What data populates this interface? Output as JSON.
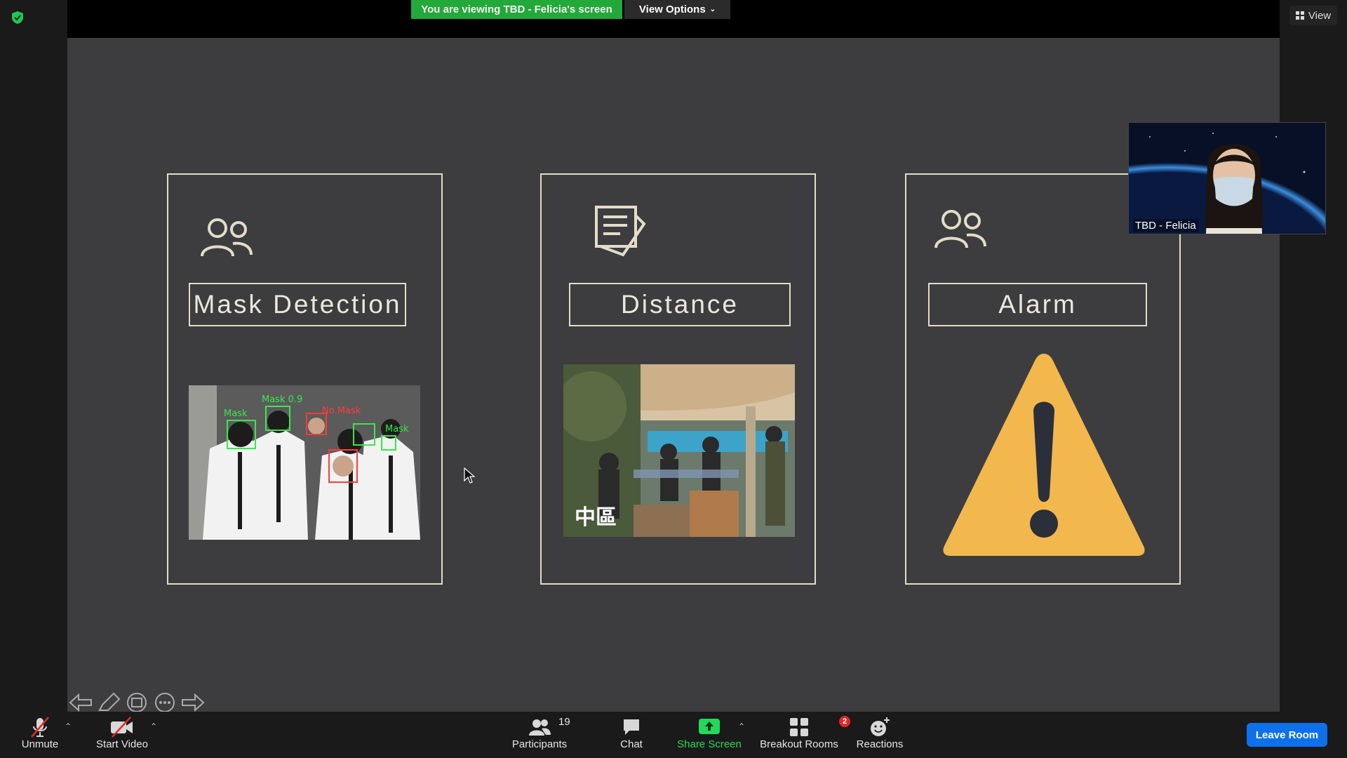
{
  "banner": {
    "viewing_text": "You are viewing TBD - Felicia's screen",
    "view_options_label": "View Options"
  },
  "top_right": {
    "view_label": "View"
  },
  "slide": {
    "cards": [
      {
        "label": "Mask Detection",
        "icon": "people-icon"
      },
      {
        "label": "Distance",
        "icon": "document-icon"
      },
      {
        "label": "Alarm",
        "icon": "people-icon"
      }
    ],
    "photo_overlay_text": "中區",
    "mask_detection_tags": [
      "Mask 0.9",
      "Mask",
      "No Mask",
      "Mask"
    ]
  },
  "participant_video": {
    "name": "TBD - Felicia"
  },
  "toolbar": {
    "unmute_label": "Unmute",
    "start_video_label": "Start Video",
    "participants_label": "Participants",
    "participants_count": "19",
    "chat_label": "Chat",
    "share_screen_label": "Share Screen",
    "breakout_rooms_label": "Breakout Rooms",
    "breakout_rooms_badge": "2",
    "reactions_label": "Reactions",
    "leave_label": "Leave Room"
  },
  "colors": {
    "banner_green": "#23a83a",
    "share_green": "#23d959",
    "leave_blue": "#0e71eb",
    "slide_bg": "#3d3d3f",
    "card_line": "#e3dcc9",
    "alarm_yellow": "#f2b84d"
  }
}
